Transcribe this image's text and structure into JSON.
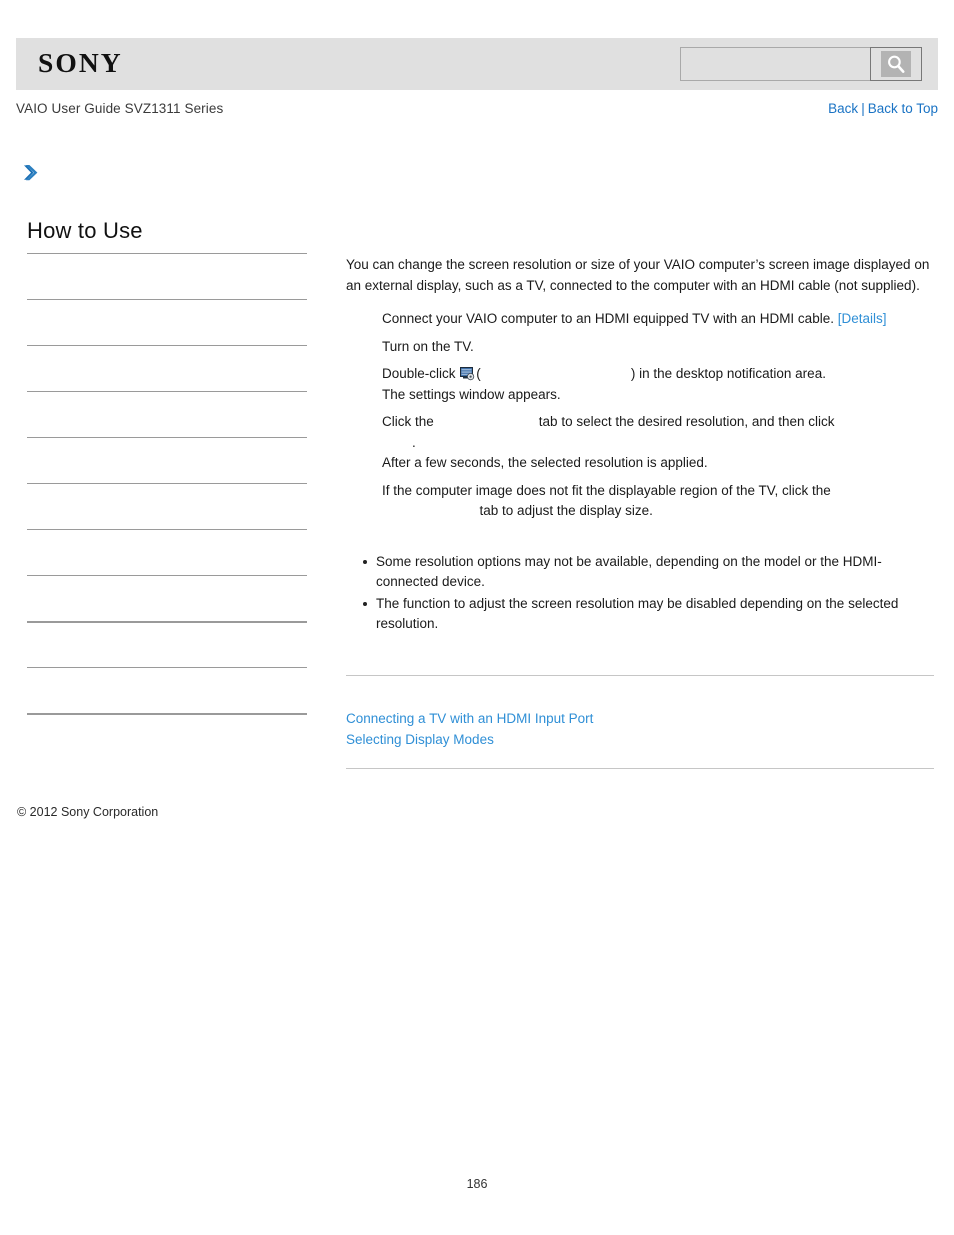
{
  "header": {
    "logo_text": "SONY",
    "search": {
      "value": "",
      "placeholder": "",
      "icon": "search-icon",
      "button_label": ""
    }
  },
  "breadcrumb": {
    "guide_title": "VAIO User Guide SVZ1311 Series",
    "back_label": "Back",
    "separator": "|",
    "back_to_top_label": "Back to Top"
  },
  "marker": {
    "icon": "chevron-right-icon"
  },
  "sidebar": {
    "heading": "How to Use",
    "items": [
      {
        "label": "",
        "thick": false
      },
      {
        "label": "",
        "thick": false
      },
      {
        "label": "",
        "thick": false
      },
      {
        "label": "",
        "thick": false
      },
      {
        "label": "",
        "thick": false
      },
      {
        "label": "",
        "thick": false
      },
      {
        "label": "",
        "thick": false
      },
      {
        "label": "",
        "thick": false
      },
      {
        "label": "",
        "thick": true
      },
      {
        "label": "",
        "thick": false
      },
      {
        "label": "",
        "thick": true
      }
    ]
  },
  "content": {
    "intro": "You can change the screen resolution or size of your VAIO computer’s screen image displayed on an external display, such as a TV, connected to the computer with an HDMI cable (not supplied).",
    "steps": [
      {
        "text_before": "Connect your VAIO computer to an HDMI equipped TV with an HDMI cable.",
        "link_label": "[Details]",
        "text_after": ""
      },
      {
        "text_before": "Turn on the TV.",
        "link_label": "",
        "text_after": ""
      },
      {
        "text_before": "Double-click",
        "icon": "display-settings-icon",
        "open_paren": "(",
        "bold_gap": "                                        ",
        "close_paren": ")",
        "text_after": " in the desktop notification area.",
        "sub_note": "The settings window appears."
      },
      {
        "text_before": "Click the",
        "bold_gap": "                            ",
        "text_mid": "tab to select the desired resolution, and then click",
        "bold_gap2": "        ",
        "trailing_period": ".",
        "sub_note": "After a few seconds, the selected resolution is applied."
      },
      {
        "text_before": "If the computer image does not fit the displayable region of the TV, click the",
        "bold_gap": "                          ",
        "text_after": "tab to adjust the display size."
      }
    ],
    "notes": [
      "Some resolution options may not be available, depending on the model or the HDMI-connected device.",
      "The function to adjust the screen resolution may be disabled depending on the selected resolution."
    ],
    "related_links": [
      "Connecting a TV with an HDMI Input Port",
      "Selecting Display Modes"
    ]
  },
  "footer": {
    "copyright": "© 2012 Sony Corporation",
    "page_number": "186"
  },
  "colors": {
    "header_band": "#e0e0e0",
    "link_blue": "#2f8fd6",
    "nav_blue": "#1a73c4",
    "chevron_blue": "#2b7fc0",
    "rule_gray": "#c6c6c6",
    "sidebar_rule": "#9a9a9a"
  }
}
